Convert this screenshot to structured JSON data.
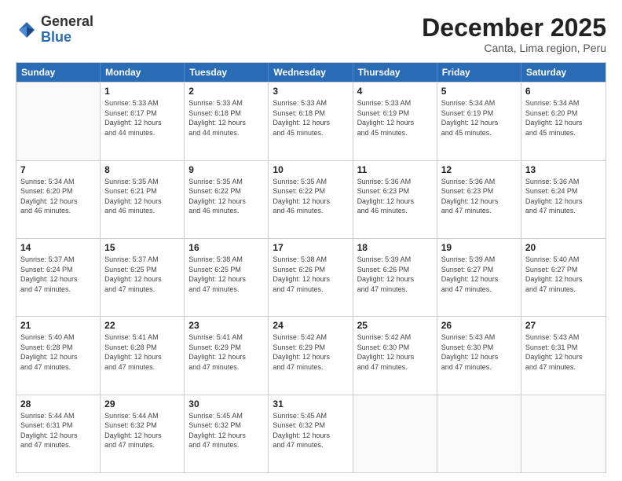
{
  "logo": {
    "general": "General",
    "blue": "Blue"
  },
  "title": "December 2025",
  "subtitle": "Canta, Lima region, Peru",
  "header_days": [
    "Sunday",
    "Monday",
    "Tuesday",
    "Wednesday",
    "Thursday",
    "Friday",
    "Saturday"
  ],
  "rows": [
    [
      {
        "day": "",
        "info": ""
      },
      {
        "day": "1",
        "info": "Sunrise: 5:33 AM\nSunset: 6:17 PM\nDaylight: 12 hours\nand 44 minutes."
      },
      {
        "day": "2",
        "info": "Sunrise: 5:33 AM\nSunset: 6:18 PM\nDaylight: 12 hours\nand 44 minutes."
      },
      {
        "day": "3",
        "info": "Sunrise: 5:33 AM\nSunset: 6:18 PM\nDaylight: 12 hours\nand 45 minutes."
      },
      {
        "day": "4",
        "info": "Sunrise: 5:33 AM\nSunset: 6:19 PM\nDaylight: 12 hours\nand 45 minutes."
      },
      {
        "day": "5",
        "info": "Sunrise: 5:34 AM\nSunset: 6:19 PM\nDaylight: 12 hours\nand 45 minutes."
      },
      {
        "day": "6",
        "info": "Sunrise: 5:34 AM\nSunset: 6:20 PM\nDaylight: 12 hours\nand 45 minutes."
      }
    ],
    [
      {
        "day": "7",
        "info": "Sunrise: 5:34 AM\nSunset: 6:20 PM\nDaylight: 12 hours\nand 46 minutes."
      },
      {
        "day": "8",
        "info": "Sunrise: 5:35 AM\nSunset: 6:21 PM\nDaylight: 12 hours\nand 46 minutes."
      },
      {
        "day": "9",
        "info": "Sunrise: 5:35 AM\nSunset: 6:22 PM\nDaylight: 12 hours\nand 46 minutes."
      },
      {
        "day": "10",
        "info": "Sunrise: 5:35 AM\nSunset: 6:22 PM\nDaylight: 12 hours\nand 46 minutes."
      },
      {
        "day": "11",
        "info": "Sunrise: 5:36 AM\nSunset: 6:23 PM\nDaylight: 12 hours\nand 46 minutes."
      },
      {
        "day": "12",
        "info": "Sunrise: 5:36 AM\nSunset: 6:23 PM\nDaylight: 12 hours\nand 47 minutes."
      },
      {
        "day": "13",
        "info": "Sunrise: 5:36 AM\nSunset: 6:24 PM\nDaylight: 12 hours\nand 47 minutes."
      }
    ],
    [
      {
        "day": "14",
        "info": "Sunrise: 5:37 AM\nSunset: 6:24 PM\nDaylight: 12 hours\nand 47 minutes."
      },
      {
        "day": "15",
        "info": "Sunrise: 5:37 AM\nSunset: 6:25 PM\nDaylight: 12 hours\nand 47 minutes."
      },
      {
        "day": "16",
        "info": "Sunrise: 5:38 AM\nSunset: 6:25 PM\nDaylight: 12 hours\nand 47 minutes."
      },
      {
        "day": "17",
        "info": "Sunrise: 5:38 AM\nSunset: 6:26 PM\nDaylight: 12 hours\nand 47 minutes."
      },
      {
        "day": "18",
        "info": "Sunrise: 5:39 AM\nSunset: 6:26 PM\nDaylight: 12 hours\nand 47 minutes."
      },
      {
        "day": "19",
        "info": "Sunrise: 5:39 AM\nSunset: 6:27 PM\nDaylight: 12 hours\nand 47 minutes."
      },
      {
        "day": "20",
        "info": "Sunrise: 5:40 AM\nSunset: 6:27 PM\nDaylight: 12 hours\nand 47 minutes."
      }
    ],
    [
      {
        "day": "21",
        "info": "Sunrise: 5:40 AM\nSunset: 6:28 PM\nDaylight: 12 hours\nand 47 minutes."
      },
      {
        "day": "22",
        "info": "Sunrise: 5:41 AM\nSunset: 6:28 PM\nDaylight: 12 hours\nand 47 minutes."
      },
      {
        "day": "23",
        "info": "Sunrise: 5:41 AM\nSunset: 6:29 PM\nDaylight: 12 hours\nand 47 minutes."
      },
      {
        "day": "24",
        "info": "Sunrise: 5:42 AM\nSunset: 6:29 PM\nDaylight: 12 hours\nand 47 minutes."
      },
      {
        "day": "25",
        "info": "Sunrise: 5:42 AM\nSunset: 6:30 PM\nDaylight: 12 hours\nand 47 minutes."
      },
      {
        "day": "26",
        "info": "Sunrise: 5:43 AM\nSunset: 6:30 PM\nDaylight: 12 hours\nand 47 minutes."
      },
      {
        "day": "27",
        "info": "Sunrise: 5:43 AM\nSunset: 6:31 PM\nDaylight: 12 hours\nand 47 minutes."
      }
    ],
    [
      {
        "day": "28",
        "info": "Sunrise: 5:44 AM\nSunset: 6:31 PM\nDaylight: 12 hours\nand 47 minutes."
      },
      {
        "day": "29",
        "info": "Sunrise: 5:44 AM\nSunset: 6:32 PM\nDaylight: 12 hours\nand 47 minutes."
      },
      {
        "day": "30",
        "info": "Sunrise: 5:45 AM\nSunset: 6:32 PM\nDaylight: 12 hours\nand 47 minutes."
      },
      {
        "day": "31",
        "info": "Sunrise: 5:45 AM\nSunset: 6:32 PM\nDaylight: 12 hours\nand 47 minutes."
      },
      {
        "day": "",
        "info": ""
      },
      {
        "day": "",
        "info": ""
      },
      {
        "day": "",
        "info": ""
      }
    ]
  ]
}
